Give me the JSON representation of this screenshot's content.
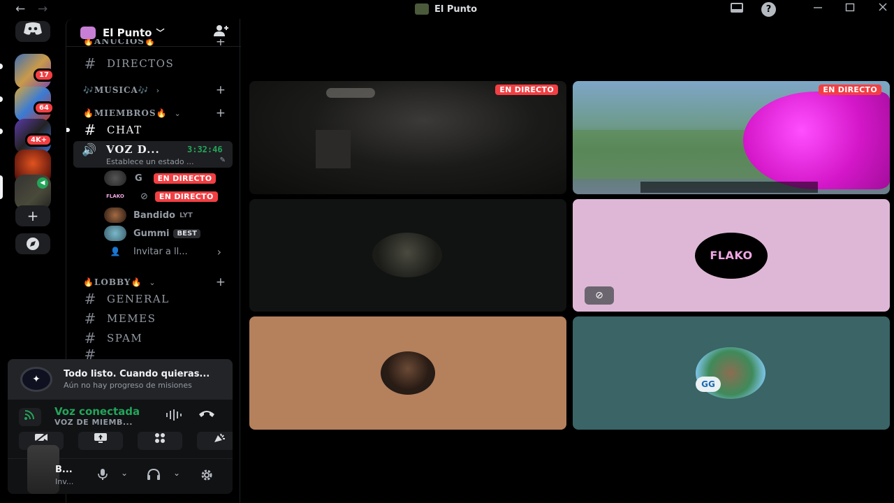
{
  "window": {
    "title": "El Punto",
    "nav_back": "←",
    "nav_forward": "→",
    "help": "?"
  },
  "rail": {
    "servers": [
      {
        "badge": "17"
      },
      {
        "badge": "64"
      },
      {
        "badge": "4K+"
      },
      {
        "badge": ""
      },
      {
        "badge": ""
      }
    ]
  },
  "guild": {
    "name": "El Punto",
    "chevron": "﹀"
  },
  "channels": {
    "category_anuncios": "🔥ANUCIOS🔥",
    "directos": "DIRECTOS",
    "category_musica": "🎶MUSICA🎶",
    "category_miembros": "🔥MIEMBROS🔥",
    "chat": "CHAT",
    "voice": {
      "name": "VOZ D...",
      "timer": "3:32:46",
      "status": "Establece un estado ..."
    },
    "voice_users": [
      {
        "name": "G",
        "live": "EN DIRECTO"
      },
      {
        "name": "",
        "live": "EN DIRECTO",
        "logo": "FLAKO"
      },
      {
        "name": "Bandido",
        "tag": "LYT"
      },
      {
        "name": "Gummi",
        "tag": "BEST"
      }
    ],
    "invite": "Invitar a ll...",
    "category_lobby": "🔥LOBBY🔥",
    "general": "GENERAL",
    "memes": "MEMES",
    "spam": "SPAM"
  },
  "panel": {
    "quest_title": "Todo listo. Cuando quieras...",
    "quest_sub": "Aún no hay progreso de misiones",
    "voice_connected": "Voz conectada",
    "voice_channel": "VOZ DE MIEMB...",
    "user_name": "B...",
    "user_status": "Inv..."
  },
  "stage": {
    "live_label": "EN DIRECTO",
    "tile_logo": "FLAKO",
    "avatar_tag": "GG",
    "tile_colors": {
      "black": "#101312",
      "pink": "#dfb7d6",
      "tan": "#b5805c",
      "teal": "#3a6466"
    }
  }
}
